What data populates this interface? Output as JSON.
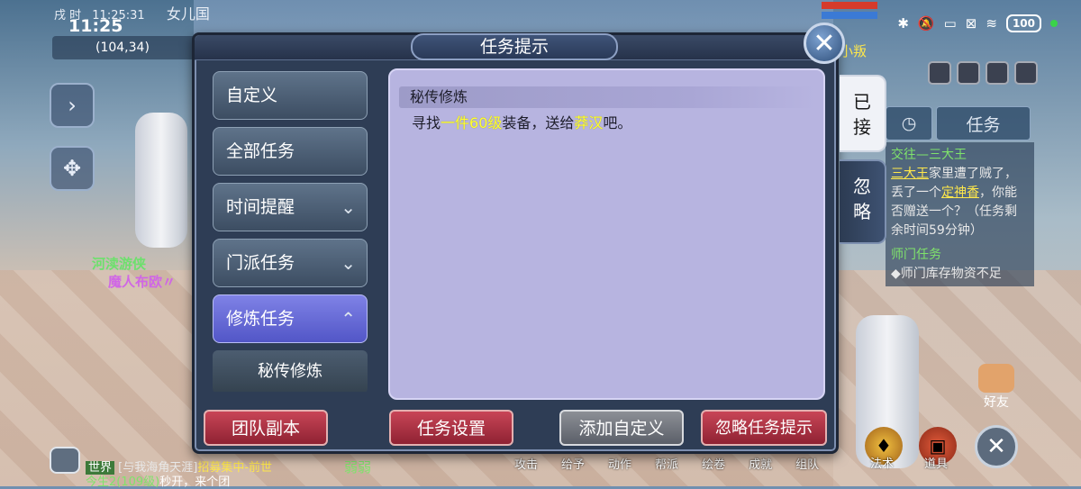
{
  "status_bar": {
    "time": "11:25",
    "battery": "100"
  },
  "hud": {
    "game_time_prefix": "戌 时",
    "game_time": "11:25:31",
    "location": "女儿国",
    "coords": "(104,34)",
    "npc_labels": [
      "河渎游侠",
      "魔人布欧〃"
    ],
    "player_name_fragment": "小叛"
  },
  "dialog": {
    "title": "任务提示",
    "menu": [
      {
        "label": "自定义",
        "chevron": ""
      },
      {
        "label": "全部任务",
        "chevron": ""
      },
      {
        "label": "时间提醒",
        "chevron": "down"
      },
      {
        "label": "门派任务",
        "chevron": "down"
      },
      {
        "label": "修炼任务",
        "chevron": "up",
        "active": true
      }
    ],
    "submenu_item": "秘传修炼",
    "quest": {
      "title": "秘传修炼",
      "text_parts": [
        "寻找",
        "一件60级",
        "装备，送给",
        "莽汉",
        "吧。"
      ]
    },
    "side_tabs": [
      "已接",
      "忽略"
    ],
    "buttons": [
      "团队副本",
      "任务设置",
      "添加自定义",
      "忽略任务提示"
    ]
  },
  "right_panel": {
    "tab_timer_icon": "clock-icon",
    "tab_label": "任务",
    "entries": [
      {
        "title": "交往—三大王",
        "text_link": "三大王",
        "text_a": "家里遭了贼了，丢了一个",
        "text_link2": "定神香",
        "text_b": "，你能否赠送一个？（任务剩余时间59分钟）"
      },
      {
        "title": "师门任务",
        "text_a": "◆师门库存物资不足"
      }
    ]
  },
  "bottom_bar": {
    "chat_channel": "世界",
    "chat_line1": "[与我海角天涯]",
    "chat_line1_tag": "招募集中-前世",
    "chat_line2_a": "今生2(109级)",
    "chat_line2_b": "秒开，来个团",
    "chat_more": "弱弱",
    "menu_items": [
      "攻击",
      "给予",
      "动作",
      "帮派",
      "绘卷",
      "成就",
      "组队",
      "法术",
      "道具"
    ],
    "friend_label": "好友"
  }
}
